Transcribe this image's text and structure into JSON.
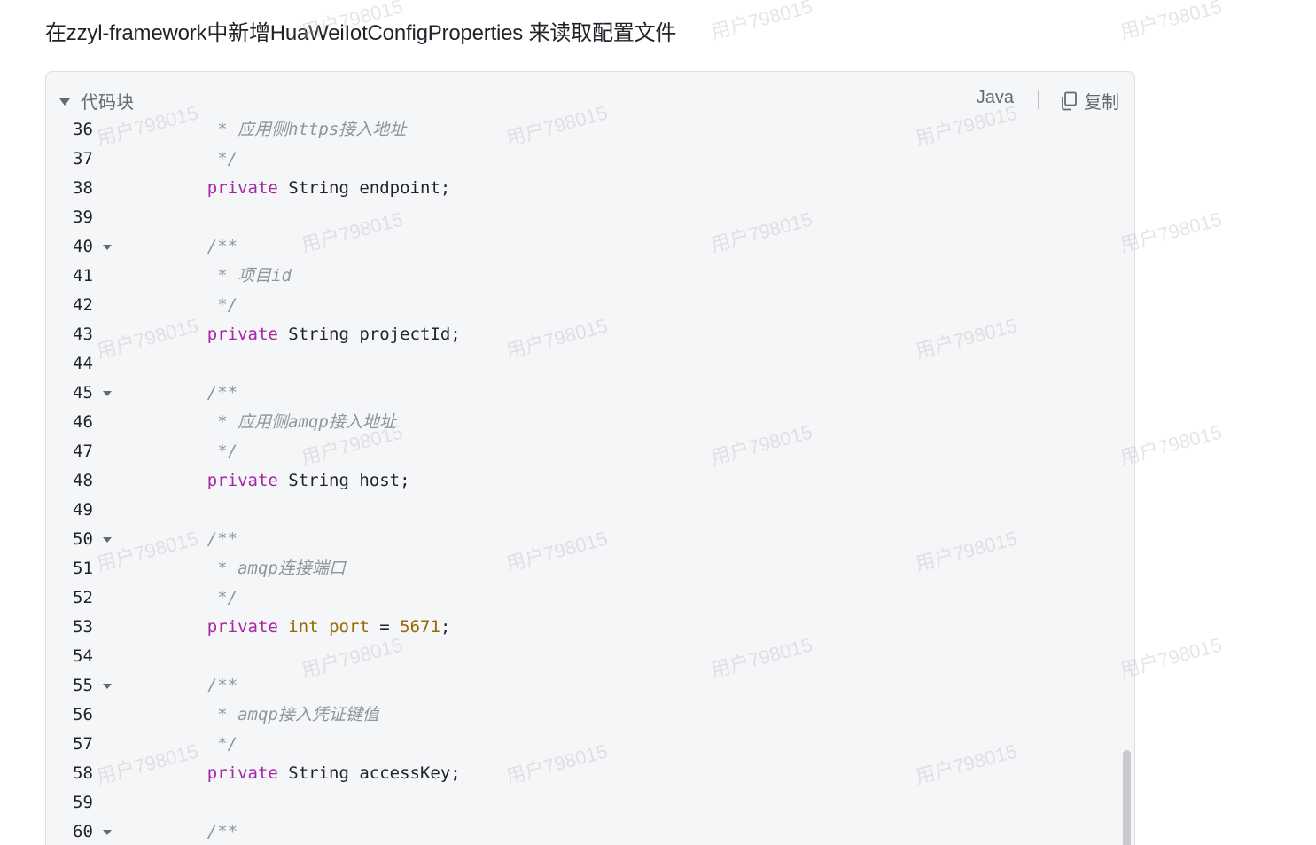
{
  "heading": "在zzyl-framework中新增HuaWeiIotConfigProperties 来读取配置文件",
  "code_block": {
    "title": "代码块",
    "language": "Java",
    "copy_label": "复制",
    "lines": [
      {
        "n": "36",
        "fold": false,
        "tokens": [
          {
            "t": "comment",
            "v": "     * 应用侧https接入地址"
          }
        ]
      },
      {
        "n": "37",
        "fold": false,
        "tokens": [
          {
            "t": "comment",
            "v": "     */"
          }
        ]
      },
      {
        "n": "38",
        "fold": false,
        "tokens": [
          {
            "t": "plain",
            "v": "    "
          },
          {
            "t": "keyword",
            "v": "private"
          },
          {
            "t": "plain",
            "v": " String endpoint;"
          }
        ]
      },
      {
        "n": "39",
        "fold": false,
        "tokens": []
      },
      {
        "n": "40",
        "fold": true,
        "tokens": [
          {
            "t": "comment",
            "v": "    /**"
          }
        ]
      },
      {
        "n": "41",
        "fold": false,
        "tokens": [
          {
            "t": "comment",
            "v": "     * 项目id"
          }
        ]
      },
      {
        "n": "42",
        "fold": false,
        "tokens": [
          {
            "t": "comment",
            "v": "     */"
          }
        ]
      },
      {
        "n": "43",
        "fold": false,
        "tokens": [
          {
            "t": "plain",
            "v": "    "
          },
          {
            "t": "keyword",
            "v": "private"
          },
          {
            "t": "plain",
            "v": " String projectId;"
          }
        ]
      },
      {
        "n": "44",
        "fold": false,
        "tokens": []
      },
      {
        "n": "45",
        "fold": true,
        "tokens": [
          {
            "t": "comment",
            "v": "    /**"
          }
        ]
      },
      {
        "n": "46",
        "fold": false,
        "tokens": [
          {
            "t": "comment",
            "v": "     * 应用侧amqp接入地址"
          }
        ]
      },
      {
        "n": "47",
        "fold": false,
        "tokens": [
          {
            "t": "comment",
            "v": "     */"
          }
        ]
      },
      {
        "n": "48",
        "fold": false,
        "tokens": [
          {
            "t": "plain",
            "v": "    "
          },
          {
            "t": "keyword",
            "v": "private"
          },
          {
            "t": "plain",
            "v": " String host;"
          }
        ]
      },
      {
        "n": "49",
        "fold": false,
        "tokens": []
      },
      {
        "n": "50",
        "fold": true,
        "tokens": [
          {
            "t": "comment",
            "v": "    /**"
          }
        ]
      },
      {
        "n": "51",
        "fold": false,
        "tokens": [
          {
            "t": "comment",
            "v": "     * amqp连接端口"
          }
        ]
      },
      {
        "n": "52",
        "fold": false,
        "tokens": [
          {
            "t": "comment",
            "v": "     */"
          }
        ]
      },
      {
        "n": "53",
        "fold": false,
        "tokens": [
          {
            "t": "plain",
            "v": "    "
          },
          {
            "t": "keyword",
            "v": "private"
          },
          {
            "t": "plain",
            "v": " "
          },
          {
            "t": "type",
            "v": "int"
          },
          {
            "t": "plain",
            "v": " "
          },
          {
            "t": "type",
            "v": "port"
          },
          {
            "t": "plain",
            "v": " = "
          },
          {
            "t": "number",
            "v": "5671"
          },
          {
            "t": "plain",
            "v": ";"
          }
        ]
      },
      {
        "n": "54",
        "fold": false,
        "tokens": []
      },
      {
        "n": "55",
        "fold": true,
        "tokens": [
          {
            "t": "comment",
            "v": "    /**"
          }
        ]
      },
      {
        "n": "56",
        "fold": false,
        "tokens": [
          {
            "t": "comment",
            "v": "     * amqp接入凭证键值"
          }
        ]
      },
      {
        "n": "57",
        "fold": false,
        "tokens": [
          {
            "t": "comment",
            "v": "     */"
          }
        ]
      },
      {
        "n": "58",
        "fold": false,
        "tokens": [
          {
            "t": "plain",
            "v": "    "
          },
          {
            "t": "keyword",
            "v": "private"
          },
          {
            "t": "plain",
            "v": " String accessKey;"
          }
        ]
      },
      {
        "n": "59",
        "fold": false,
        "tokens": []
      },
      {
        "n": "60",
        "fold": true,
        "tokens": [
          {
            "t": "comment",
            "v": "    /**"
          }
        ]
      }
    ]
  },
  "watermark_text": "用户798015",
  "icons": {
    "collapse": "caret-down-icon",
    "copy": "copy-icon",
    "fold": "fold-caret-icon"
  }
}
